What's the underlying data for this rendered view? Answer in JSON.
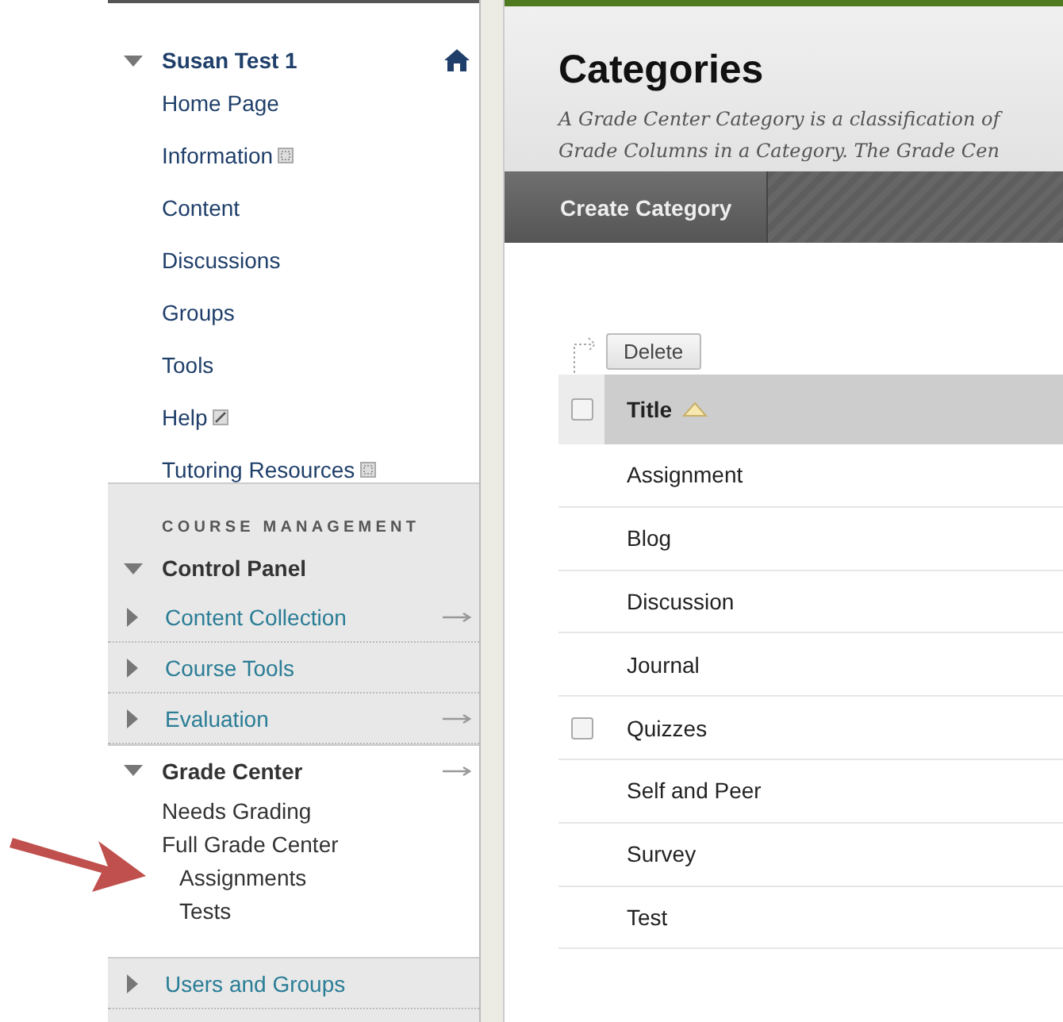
{
  "course_menu": {
    "title": "Susan Test 1",
    "expanded": true,
    "items": [
      {
        "label": "Home Page",
        "kind": "link"
      },
      {
        "label": "Information",
        "kind": "content-area"
      },
      {
        "label": "Content",
        "kind": "link"
      },
      {
        "label": "Discussions",
        "kind": "link"
      },
      {
        "label": "Groups",
        "kind": "link"
      },
      {
        "label": "Tools",
        "kind": "link"
      },
      {
        "label": "Help",
        "kind": "external"
      },
      {
        "label": "Tutoring Resources",
        "kind": "content-area"
      }
    ]
  },
  "course_management": {
    "heading": "COURSE MANAGEMENT",
    "title": "Control Panel",
    "sections": [
      {
        "label": "Content Collection",
        "expanded": false,
        "arrow": true
      },
      {
        "label": "Course Tools",
        "expanded": false,
        "arrow": false
      },
      {
        "label": "Evaluation",
        "expanded": false,
        "arrow": true
      },
      {
        "label": "Grade Center",
        "expanded": true,
        "arrow": true,
        "children": [
          {
            "label": "Needs Grading"
          },
          {
            "label": "Full Grade Center",
            "children": [
              {
                "label": "Assignments"
              },
              {
                "label": "Tests"
              }
            ]
          }
        ]
      },
      {
        "label": "Users and Groups",
        "expanded": false,
        "arrow": false
      }
    ]
  },
  "page": {
    "title": "Categories",
    "description_lines": [
      "A Grade Center Category is a classification of",
      "Grade Columns in a Category. The Grade Cen"
    ],
    "action_bar": [
      "Create Category"
    ],
    "delete_button": "Delete",
    "table": {
      "columns": [
        {
          "label": "Title",
          "sorted": true
        }
      ],
      "header_checked": false,
      "rows": [
        {
          "title": "Assignment",
          "hovered": false
        },
        {
          "title": "Blog",
          "hovered": false
        },
        {
          "title": "Discussion",
          "hovered": false
        },
        {
          "title": "Journal",
          "hovered": false
        },
        {
          "title": "Quizzes",
          "hovered": true
        },
        {
          "title": "Self and Peer",
          "hovered": false
        },
        {
          "title": "Survey",
          "hovered": false
        },
        {
          "title": "Test",
          "hovered": false
        }
      ]
    }
  }
}
